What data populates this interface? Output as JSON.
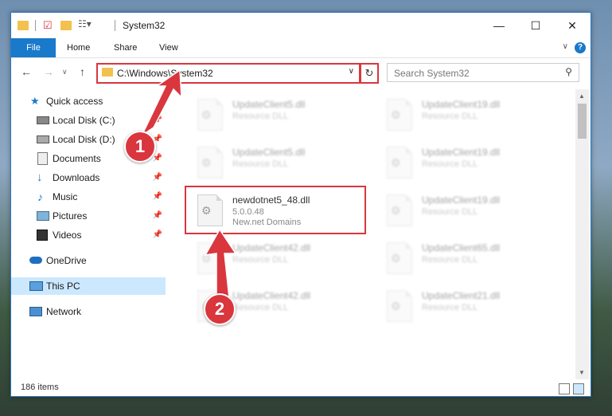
{
  "window": {
    "title": "System32",
    "controls": {
      "minimize": "—",
      "maximize": "☐",
      "close": "✕"
    }
  },
  "ribbon": {
    "tabs": [
      "File",
      "Home",
      "Share",
      "View"
    ],
    "help": "?"
  },
  "address": {
    "path": "C:\\Windows\\System32",
    "search_placeholder": "Search System32"
  },
  "nav": {
    "items": [
      {
        "label": "Quick access",
        "icon": "star-icon",
        "pinned": false
      },
      {
        "label": "Local Disk (C:)",
        "icon": "drive-icon",
        "pinned": true
      },
      {
        "label": "Local Disk (D:)",
        "icon": "drive-icon",
        "pinned": true
      },
      {
        "label": "Documents",
        "icon": "documents-icon",
        "pinned": true
      },
      {
        "label": "Downloads",
        "icon": "download-arrow-icon",
        "pinned": true
      },
      {
        "label": "Music",
        "icon": "music-note-icon",
        "pinned": true
      },
      {
        "label": "Pictures",
        "icon": "pictures-icon",
        "pinned": true
      },
      {
        "label": "Videos",
        "icon": "film-icon",
        "pinned": true
      },
      {
        "label": "OneDrive",
        "icon": "cloud-icon",
        "pinned": false
      },
      {
        "label": "This PC",
        "icon": "monitor-icon",
        "pinned": false
      },
      {
        "label": "Network",
        "icon": "network-icon",
        "pinned": false
      }
    ],
    "selected": "This PC"
  },
  "files": {
    "highlighted": {
      "name": "newdotnet5_48.dll",
      "version": "5.0.0.48",
      "company": "New.net Domains"
    },
    "blurred": [
      {
        "name": "UpdateClient5.dll",
        "type": "Resource DLL"
      },
      {
        "name": "UpdateClient19.dll",
        "type": "Resource DLL"
      },
      {
        "name": "UpdateClient5.dll",
        "type": "Resource DLL"
      },
      {
        "name": "UpdateClient19.dll",
        "type": "Resource DLL"
      },
      {
        "name": "UpdateClient19.dll",
        "type": "Resource DLL"
      },
      {
        "name": "UpdateClient42.dll",
        "type": "Resource DLL"
      },
      {
        "name": "UpdateClient65.dll",
        "type": "Resource DLL"
      },
      {
        "name": "UpdateClient42.dll",
        "type": "Resource DLL"
      },
      {
        "name": "UpdateClient21.dll",
        "type": "Resource DLL"
      }
    ]
  },
  "status": {
    "count": "186 items"
  },
  "annotations": {
    "step1": "1",
    "step2": "2"
  },
  "colors": {
    "accent": "#1979ca",
    "annotation": "#d9363e",
    "selected": "#cce8ff"
  }
}
